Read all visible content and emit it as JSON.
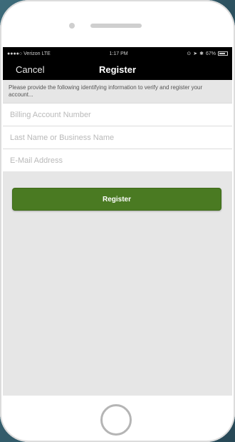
{
  "status_bar": {
    "carrier": "Verizon",
    "network": "LTE",
    "time": "1:17 PM",
    "battery": "67%"
  },
  "nav": {
    "cancel_label": "Cancel",
    "title": "Register"
  },
  "form": {
    "intro_text": "Please provide the following identifying information to verify and register your account...",
    "billing_account_placeholder": "Billing Account Number",
    "last_name_placeholder": "Last Name or Business Name",
    "email_placeholder": "E-Mail Address",
    "submit_label": "Register"
  },
  "colors": {
    "accent": "#4a7a22",
    "navbar": "#000000",
    "screen_bg": "#e6e6e6"
  }
}
